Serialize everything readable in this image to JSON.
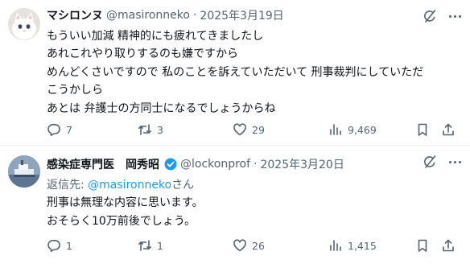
{
  "tweets": [
    {
      "display_name": "マシロンヌ",
      "handle": "@masironneko",
      "separator": "·",
      "date": "2025年3月19日",
      "lines": [
        "もういい加減 精神的にも疲れてきましたし",
        "あれこれやり取りするのも嫌ですから",
        "めんどくさいですので 私のことを訴えていただいて 刑事裁判にしていただ",
        "こうかしら",
        "あとは 弁護士の方同士になるでしょうからね"
      ],
      "stats": {
        "replies": "7",
        "retweets": "3",
        "likes": "29",
        "views": "9,469"
      }
    },
    {
      "display_name": "感染症専門医　岡秀昭",
      "verified": true,
      "handle": "@lockonprof",
      "separator": "·",
      "date": "2025年3月20日",
      "reply_to": {
        "prefix": "返信先: ",
        "mention": "@masironneko",
        "suffix": "さん"
      },
      "lines": [
        "刑事は無理な内容に思います。",
        "おそらく10万前後でしょう。"
      ],
      "stats": {
        "replies": "1",
        "retweets": "1",
        "likes": "26",
        "views": "1,415"
      }
    }
  ],
  "colors": {
    "accent": "#1d9bf0",
    "muted": "#536471",
    "text": "#0f1419",
    "divider": "#eff3f4"
  },
  "icons": [
    "grok-icon",
    "more-icon",
    "reply-icon",
    "retweet-icon",
    "like-icon",
    "views-icon",
    "bookmark-icon",
    "share-icon",
    "verified-badge-icon"
  ]
}
